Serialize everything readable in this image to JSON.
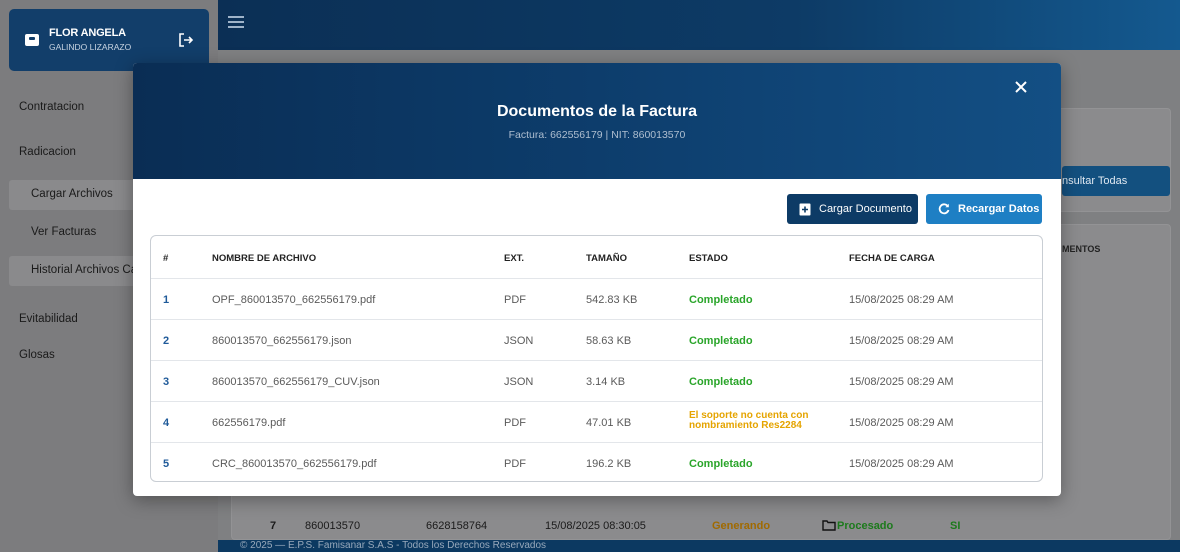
{
  "user": {
    "name": "FLOR ANGELA",
    "surname": "GALINDO LIZARAZO"
  },
  "sidebar": {
    "items": [
      {
        "label": "Contratacion"
      },
      {
        "label": "Radicacion"
      },
      {
        "label": "Cargar Archivos"
      },
      {
        "label": "Ver Facturas"
      },
      {
        "label": "Historial Archivos Ca"
      },
      {
        "label": "Evitabilidad"
      },
      {
        "label": "Glosas"
      }
    ]
  },
  "background": {
    "consult_button": "nsultar Todas",
    "column_header": "MENTOS",
    "row": {
      "num": "7",
      "nit": "860013570",
      "factura": "6628158764",
      "date": "15/08/2025 08:30:05",
      "state1": "Generando",
      "state2": "Procesado",
      "flag": "SI"
    },
    "footer": "© 2025 — E.P.S. Famisanar S.A.S - Todos los Derechos Reservados"
  },
  "modal": {
    "title": "Documentos de la Factura",
    "subtitle": "Factura: 662556179 | NIT: 860013570",
    "upload_button": "Cargar Documento",
    "reload_button": "Recargar Datos",
    "columns": [
      "#",
      "NOMBRE DE ARCHIVO",
      "EXT.",
      "TAMAÑO",
      "ESTADO",
      "FECHA DE CARGA"
    ],
    "rows": [
      {
        "num": "1",
        "name": "OPF_860013570_662556179.pdf",
        "ext": "PDF",
        "size": "542.83 KB",
        "state": "Completado",
        "date": "15/08/2025 08:29 AM"
      },
      {
        "num": "2",
        "name": "860013570_662556179.json",
        "ext": "JSON",
        "size": "58.63 KB",
        "state": "Completado",
        "date": "15/08/2025 08:29 AM"
      },
      {
        "num": "3",
        "name": "860013570_662556179_CUV.json",
        "ext": "JSON",
        "size": "3.14 KB",
        "state": "Completado",
        "date": "15/08/2025 08:29 AM"
      },
      {
        "num": "4",
        "name": "662556179.pdf",
        "ext": "PDF",
        "size": "47.01 KB",
        "state_line1": "El soporte no cuenta con",
        "state_line2": "nombramiento Res2284",
        "date": "15/08/2025 08:29 AM"
      },
      {
        "num": "5",
        "name": "CRC_860013570_662556179.pdf",
        "ext": "PDF",
        "size": "196.2 KB",
        "state": "Completado",
        "date": "15/08/2025 08:29 AM"
      }
    ]
  },
  "colors": {
    "primary": "#0d3b66",
    "accent": "#1e7fc4",
    "success": "#2aa52a",
    "warning": "#e5a400"
  }
}
